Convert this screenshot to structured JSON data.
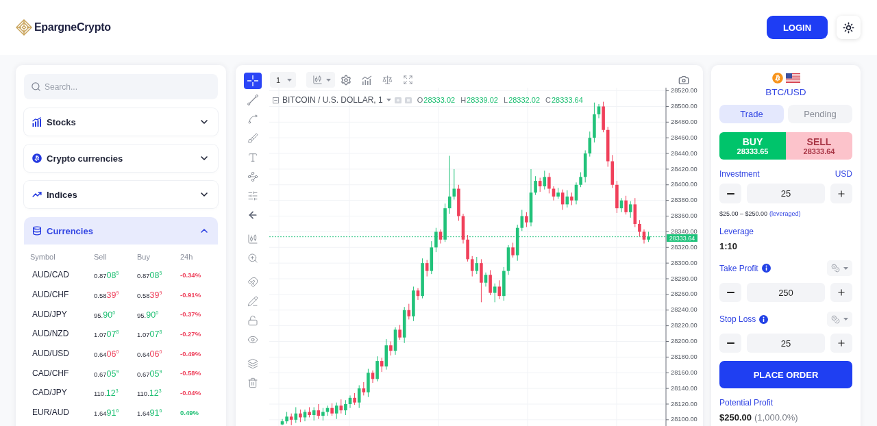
{
  "header": {
    "brand": "EpargneCrypto",
    "login": "LOGIN"
  },
  "markets": {
    "search": {
      "placeholder": "Search..."
    },
    "categories": [
      {
        "kind": "stocks",
        "label": "Stocks",
        "expanded": false
      },
      {
        "kind": "crypto",
        "label": "Crypto currencies",
        "expanded": false
      },
      {
        "kind": "indices",
        "label": "Indices",
        "expanded": false
      },
      {
        "kind": "currencies",
        "label": "Currencies",
        "expanded": true,
        "table": {
          "columns": [
            "Symbol",
            "Sell",
            "Buy",
            "24h"
          ],
          "rows": [
            {
              "symbol": "AUD/CAD",
              "sell": {
                "base": "0.87",
                "big": "08",
                "pip": "5"
              },
              "buy": {
                "base": "0.87",
                "big": "08",
                "pip": "5"
              },
              "price_up": true,
              "change": "-0.34%",
              "change_up": false
            },
            {
              "symbol": "AUD/CHF",
              "sell": {
                "base": "0.58",
                "big": "39",
                "pip": "9"
              },
              "buy": {
                "base": "0.58",
                "big": "39",
                "pip": "9"
              },
              "price_up": false,
              "change": "-0.91%",
              "change_up": false
            },
            {
              "symbol": "AUD/JPY",
              "sell": {
                "base": "95.",
                "big": "90",
                "pip": "0"
              },
              "buy": {
                "base": "95.",
                "big": "90",
                "pip": "0"
              },
              "price_up": true,
              "change": "-0.37%",
              "change_up": false
            },
            {
              "symbol": "AUD/NZD",
              "sell": {
                "base": "1.07",
                "big": "07",
                "pip": "8"
              },
              "buy": {
                "base": "1.07",
                "big": "07",
                "pip": "8"
              },
              "price_up": true,
              "change": "-0.27%",
              "change_up": false
            },
            {
              "symbol": "AUD/USD",
              "sell": {
                "base": "0.64",
                "big": "06",
                "pip": "0"
              },
              "buy": {
                "base": "0.64",
                "big": "06",
                "pip": "0"
              },
              "price_up": false,
              "change": "-0.49%",
              "change_up": false
            },
            {
              "symbol": "CAD/CHF",
              "sell": {
                "base": "0.67",
                "big": "05",
                "pip": "9"
              },
              "buy": {
                "base": "0.67",
                "big": "05",
                "pip": "9"
              },
              "price_up": true,
              "change": "-0.58%",
              "change_up": false
            },
            {
              "symbol": "CAD/JPY",
              "sell": {
                "base": "110.",
                "big": "12",
                "pip": "3"
              },
              "buy": {
                "base": "110.",
                "big": "12",
                "pip": "3"
              },
              "price_up": true,
              "change": "-0.04%",
              "change_up": false
            },
            {
              "symbol": "EUR/AUD",
              "sell": {
                "base": "1.64",
                "big": "91",
                "pip": "6"
              },
              "buy": {
                "base": "1.64",
                "big": "91",
                "pip": "6"
              },
              "price_up": true,
              "change": "0.49%",
              "change_up": true
            }
          ]
        }
      }
    ]
  },
  "chart": {
    "interval": "1",
    "tool_groups": [
      {
        "tools": [
          {
            "kind": "crosshair",
            "selected": true
          },
          {
            "kind": "trend-line",
            "selected": false
          },
          {
            "kind": "spline",
            "selected": false
          },
          {
            "kind": "brush",
            "selected": false
          },
          {
            "kind": "text",
            "selected": false
          },
          {
            "kind": "pattern",
            "selected": false
          },
          {
            "kind": "measure",
            "selected": false
          },
          {
            "kind": "back",
            "selected": false
          }
        ]
      },
      {
        "tools": [
          {
            "kind": "candles",
            "selected": false
          },
          {
            "kind": "zoom",
            "selected": false
          }
        ]
      },
      {
        "tools": [
          {
            "kind": "magnet",
            "selected": false
          },
          {
            "kind": "pencil",
            "selected": false
          },
          {
            "kind": "lock",
            "selected": false
          },
          {
            "kind": "eye",
            "selected": false
          }
        ]
      },
      {
        "tools": [
          {
            "kind": "layers",
            "selected": false
          },
          {
            "kind": "trash",
            "selected": false
          }
        ]
      }
    ],
    "legend": {
      "title": "BITCOIN / U.S. DOLLAR, 1",
      "values": [
        {
          "label": "O",
          "value": "28333.02"
        },
        {
          "label": "H",
          "value": "28339.02"
        },
        {
          "label": "L",
          "value": "28332.02"
        },
        {
          "label": "C",
          "value": "28333.64"
        }
      ]
    },
    "chart_data": {
      "type": "candlestick",
      "grid": true,
      "ohlc": [
        [
          28094,
          28101,
          28093,
          28098
        ],
        [
          28098,
          28110,
          28095,
          28104
        ],
        [
          28104,
          28108,
          28093,
          28100
        ],
        [
          28100,
          28116,
          28096,
          28108
        ],
        [
          28108,
          28113,
          28097,
          28103
        ],
        [
          28103,
          28113,
          28098,
          28110
        ],
        [
          28110,
          28116,
          28103,
          28106
        ],
        [
          28106,
          28116,
          28099,
          28112
        ],
        [
          28112,
          28120,
          28101,
          28105
        ],
        [
          28105,
          28115,
          28099,
          28110
        ],
        [
          28110,
          28118,
          28105,
          28115
        ],
        [
          28115,
          28121,
          28105,
          28108
        ],
        [
          28108,
          28122,
          28101,
          28118
        ],
        [
          28118,
          28126,
          28108,
          28112
        ],
        [
          28112,
          28125,
          28106,
          28120
        ],
        [
          28120,
          28131,
          28115,
          28128
        ],
        [
          28128,
          28134,
          28119,
          28122
        ],
        [
          28122,
          28144,
          28115,
          28140
        ],
        [
          28140,
          28148,
          28131,
          28135
        ],
        [
          28135,
          28165,
          28129,
          28160
        ],
        [
          28160,
          28163,
          28147,
          28152
        ],
        [
          28152,
          28181,
          28149,
          28175
        ],
        [
          28175,
          28179,
          28161,
          28168
        ],
        [
          28168,
          28203,
          28164,
          28195
        ],
        [
          28195,
          28200,
          28182,
          28188
        ],
        [
          28188,
          28218,
          28183,
          28215
        ],
        [
          28215,
          28221,
          28202,
          28205
        ],
        [
          28205,
          28244,
          28198,
          28240
        ],
        [
          28240,
          28248,
          28228,
          28232
        ],
        [
          28232,
          28270,
          28226,
          28265
        ],
        [
          28265,
          28268,
          28253,
          28258
        ],
        [
          28258,
          28306,
          28255,
          28300
        ],
        [
          28300,
          28304,
          28283,
          28290
        ],
        [
          28290,
          28328,
          28286,
          28320
        ],
        [
          28320,
          28345,
          28314,
          28340
        ],
        [
          28340,
          28343,
          28325,
          28330
        ],
        [
          28330,
          28376,
          28327,
          28370
        ],
        [
          28370,
          28437,
          28363,
          28385
        ],
        [
          28385,
          28420,
          28381,
          28395
        ],
        [
          28395,
          28400,
          28354,
          28360
        ],
        [
          28360,
          28363,
          28325,
          28330
        ],
        [
          28330,
          28336,
          28302,
          28305
        ],
        [
          28305,
          28309,
          28283,
          28290
        ],
        [
          28290,
          28308,
          28286,
          28300
        ],
        [
          28300,
          28305,
          28250,
          28275
        ],
        [
          28275,
          28288,
          28270,
          28285
        ],
        [
          28285,
          28291,
          28259,
          28262
        ],
        [
          28262,
          28274,
          28250,
          28270
        ],
        [
          28270,
          28278,
          28254,
          28258
        ],
        [
          28258,
          28295,
          28252,
          28290
        ],
        [
          28290,
          28323,
          28285,
          28320
        ],
        [
          28320,
          28326,
          28307,
          28310
        ],
        [
          28310,
          28349,
          28303,
          28345
        ],
        [
          28345,
          28368,
          28341,
          28360
        ],
        [
          28360,
          28365,
          28346,
          28352
        ],
        [
          28352,
          28420,
          28347,
          28390
        ],
        [
          28390,
          28411,
          28387,
          28405
        ],
        [
          28405,
          28409,
          28391,
          28398
        ],
        [
          28398,
          28418,
          28394,
          28410
        ],
        [
          28410,
          28415,
          28389,
          28395
        ],
        [
          28395,
          28398,
          28380,
          28385
        ],
        [
          28385,
          28396,
          28382,
          28390
        ],
        [
          28390,
          28394,
          28368,
          28375
        ],
        [
          28375,
          28393,
          28371,
          28385
        ],
        [
          28385,
          28390,
          28374,
          28380
        ],
        [
          28380,
          28403,
          28375,
          28400
        ],
        [
          28400,
          28416,
          28397,
          28410
        ],
        [
          28410,
          28444,
          28403,
          28440
        ],
        [
          28440,
          28468,
          28436,
          28460
        ],
        [
          28460,
          28505,
          28454,
          28490
        ],
        [
          28490,
          28503,
          28485,
          28500
        ],
        [
          28500,
          28506,
          28467,
          28470
        ],
        [
          28470,
          28474,
          28423,
          28430
        ],
        [
          28430,
          28438,
          28396,
          28400
        ],
        [
          28400,
          28405,
          28364,
          28370
        ],
        [
          28370,
          28383,
          28365,
          28380
        ],
        [
          28380,
          28386,
          28362,
          28365
        ],
        [
          28365,
          28379,
          28358,
          28375
        ],
        [
          28375,
          28383,
          28346,
          28350
        ],
        [
          28350,
          28355,
          28334,
          28340
        ],
        [
          28340,
          28343,
          28325,
          28330
        ],
        [
          28330,
          28340,
          28327,
          28334
        ]
      ],
      "ylim": [
        28092,
        28524
      ],
      "yticks": [
        {
          "value": 28520,
          "label": "28520.00"
        },
        {
          "value": 28500,
          "label": "28500.00"
        },
        {
          "value": 28480,
          "label": "28480.00"
        },
        {
          "value": 28460,
          "label": "28460.00"
        },
        {
          "value": 28440,
          "label": "28440.00"
        },
        {
          "value": 28420,
          "label": "28420.00"
        },
        {
          "value": 28400,
          "label": "28400.00"
        },
        {
          "value": 28380,
          "label": "28380.00"
        },
        {
          "value": 28360,
          "label": "28360.00"
        },
        {
          "value": 28340,
          "label": "28340.00"
        },
        {
          "value": 28320,
          "label": "28320.00"
        },
        {
          "value": 28300,
          "label": "28300.00"
        },
        {
          "value": 28280,
          "label": "28280.00"
        },
        {
          "value": 28260,
          "label": "28260.00"
        },
        {
          "value": 28240,
          "label": "28240.00"
        },
        {
          "value": 28220,
          "label": "28220.00"
        },
        {
          "value": 28200,
          "label": "28200.00"
        },
        {
          "value": 28180,
          "label": "28180.00"
        },
        {
          "value": 28160,
          "label": "28160.00"
        },
        {
          "value": 28140,
          "label": "28140.00"
        },
        {
          "value": 28120,
          "label": "28120.00"
        },
        {
          "value": 28100,
          "label": "28100.00"
        }
      ],
      "ref_lines": [
        {
          "axis": "y",
          "value": 28333.64,
          "label": "28333.64",
          "color": "#37c98a"
        }
      ]
    }
  },
  "order": {
    "pair": "BTC/USD",
    "tabs": [
      {
        "label": "Trade",
        "selected": true
      },
      {
        "label": "Pending",
        "selected": false
      }
    ],
    "sides": [
      {
        "kind": "buy",
        "label": "BUY",
        "price": "28333.65",
        "selected": true
      },
      {
        "kind": "sell",
        "label": "SELL",
        "price": "28333.64",
        "selected": false
      }
    ],
    "investment": {
      "label": "Investment",
      "currency": "USD",
      "value": "25",
      "range": "$25.00 – $250.00",
      "note": "(leveraged)"
    },
    "leverage": {
      "label": "Leverage",
      "value": "1:10"
    },
    "protections": [
      {
        "label": "Take Profit",
        "value": "250"
      },
      {
        "label": "Stop Loss",
        "value": "25"
      }
    ],
    "submit": "PLACE ORDER",
    "potential_profit": {
      "label": "Potential Profit",
      "value": "$250.00",
      "percent": "(1,000.0%)"
    }
  }
}
